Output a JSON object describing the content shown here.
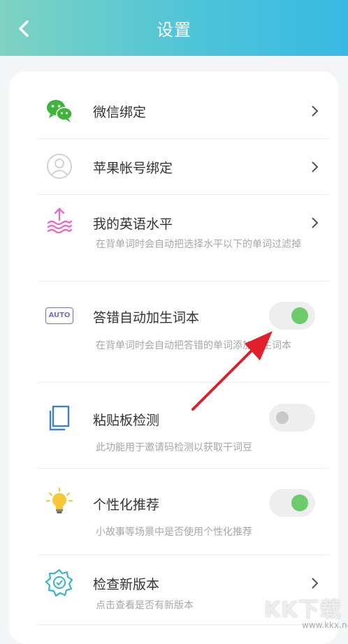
{
  "header": {
    "title": "设置"
  },
  "settings": [
    {
      "label": "微信绑定"
    },
    {
      "label": "苹果帐号绑定"
    },
    {
      "label": "我的英语水平",
      "subtitle": "在背单词时会自动把选择水平以下的单词过滤掉"
    },
    {
      "label": "答错自动加生词本",
      "subtitle": "在背单词时会自动把答错的单词添加到生词本",
      "icon_text": "AUTO",
      "toggle": "on"
    },
    {
      "label": "粘贴板检测",
      "subtitle": "此功能用于邀请码检测以获取干词豆",
      "toggle": "off"
    },
    {
      "label": "个性化推荐",
      "subtitle": "小故事等场景中是否使用个性化推荐",
      "toggle": "on"
    },
    {
      "label": "检查新版本",
      "subtitle": "点击查看是否有新版本"
    }
  ],
  "icons": {
    "wechat": "wechat-icon",
    "apple_account": "user-circle-icon",
    "level": "wave-up-icon",
    "auto": "auto-icon",
    "clipboard": "clipboard-icon",
    "recommend": "lightbulb-icon",
    "update": "gear-check-icon"
  },
  "colors": {
    "header_start": "#7ed3c2",
    "header_end": "#38b9e3",
    "toggle_on": "#6ccb6a",
    "annotation_arrow": "#e0202a"
  },
  "watermark": {
    "brand": "KK下载",
    "url": "www.kkx.net"
  }
}
